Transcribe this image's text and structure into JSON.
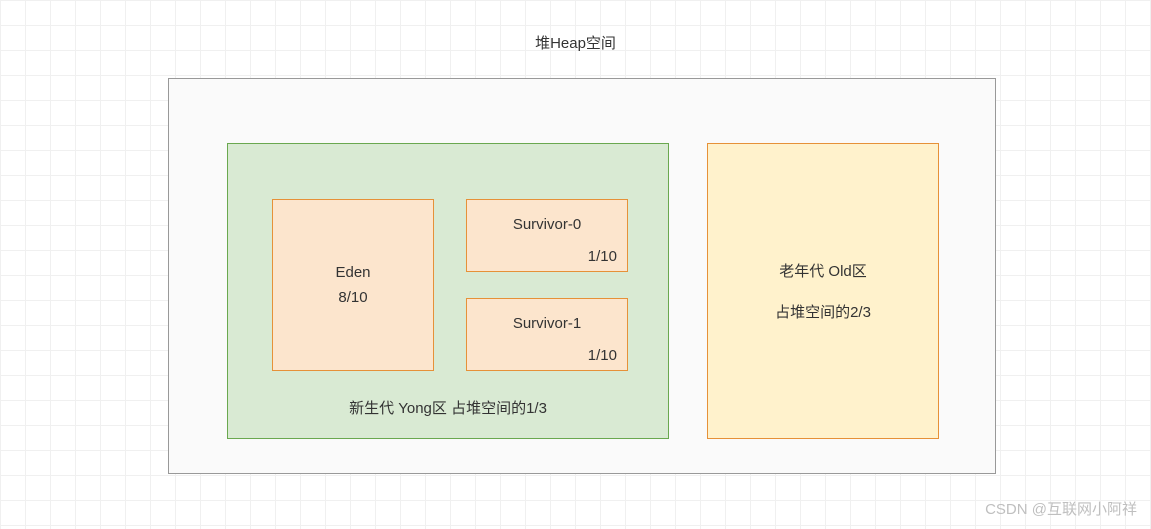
{
  "title": "堆Heap空间",
  "young": {
    "caption": "新生代 Yong区 占堆空间的1/3",
    "eden": {
      "name": "Eden",
      "ratio": "8/10"
    },
    "survivor0": {
      "name": "Survivor-0",
      "ratio": "1/10"
    },
    "survivor1": {
      "name": "Survivor-1",
      "ratio": "1/10"
    }
  },
  "old": {
    "name": "老年代 Old区",
    "ratio": "占堆空间的2/3"
  },
  "watermark": "CSDN @互联网小阿祥"
}
